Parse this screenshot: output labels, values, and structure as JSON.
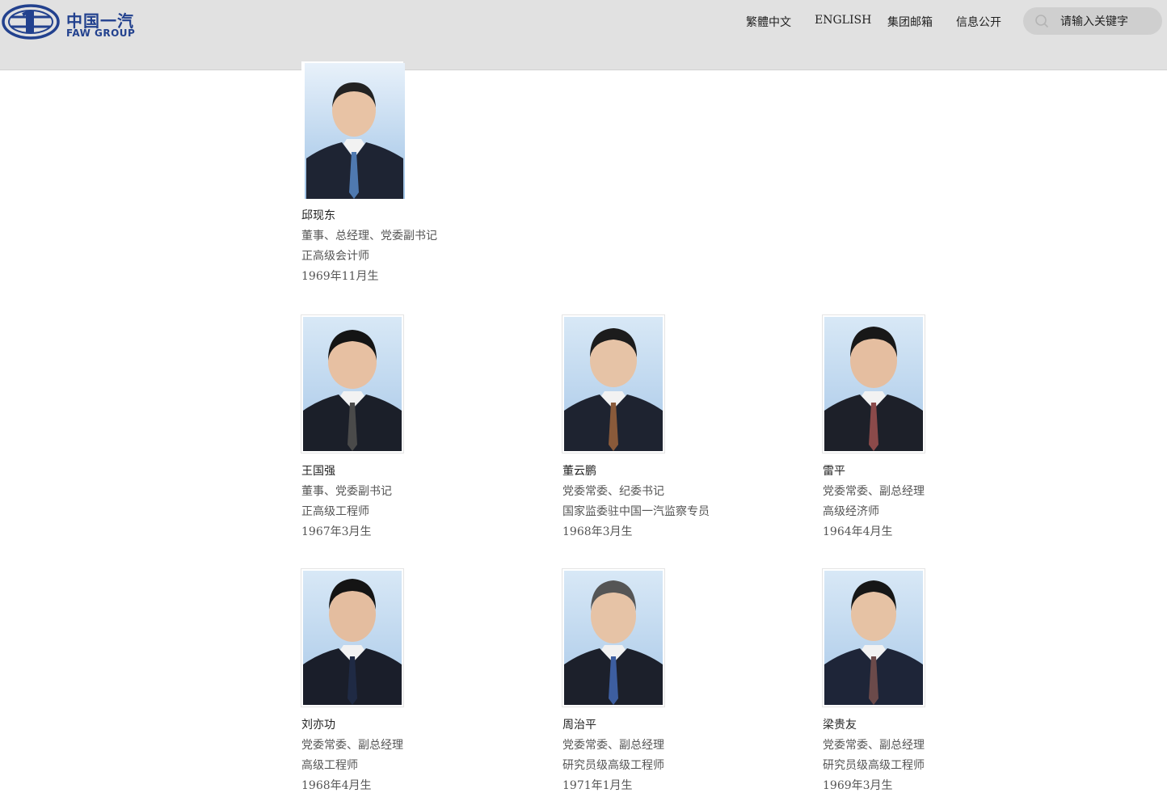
{
  "header": {
    "logo_cn": "中国一汽",
    "logo_en": "FAW GROUP",
    "nav": [
      "繁體中文",
      "ENGLISH",
      "集团邮箱",
      "信息公开"
    ],
    "search_placeholder": "请输入关键字"
  },
  "people": [
    {
      "name": "邱现东",
      "title": "董事、总经理、党委副书记",
      "qualification": "正高级会计师",
      "born": "1969年11月生"
    },
    {
      "name": "王国强",
      "title": "董事、党委副书记",
      "qualification": "正高级工程师",
      "born": "1967年3月生"
    },
    {
      "name": "董云鹏",
      "title": "党委常委、纪委书记",
      "qualification": "国家监委驻中国一汽监察专员",
      "born": "1968年3月生"
    },
    {
      "name": "雷平",
      "title": "党委常委、副总经理",
      "qualification": "高级经济师",
      "born": "1964年4月生"
    },
    {
      "name": "刘亦功",
      "title": "党委常委、副总经理",
      "qualification": "高级工程师",
      "born": "1968年4月生"
    },
    {
      "name": "周治平",
      "title": "党委常委、副总经理",
      "qualification": "研究员级高级工程师",
      "born": "1971年1月生"
    },
    {
      "name": "梁贵友",
      "title": "党委常委、副总经理",
      "qualification": "研究员级高级工程师",
      "born": "1969年3月生"
    }
  ],
  "colors": {
    "header_bg": "#e1e1e1",
    "brand_blue": "#22418e",
    "photo_sky": "#bcd6ef"
  }
}
